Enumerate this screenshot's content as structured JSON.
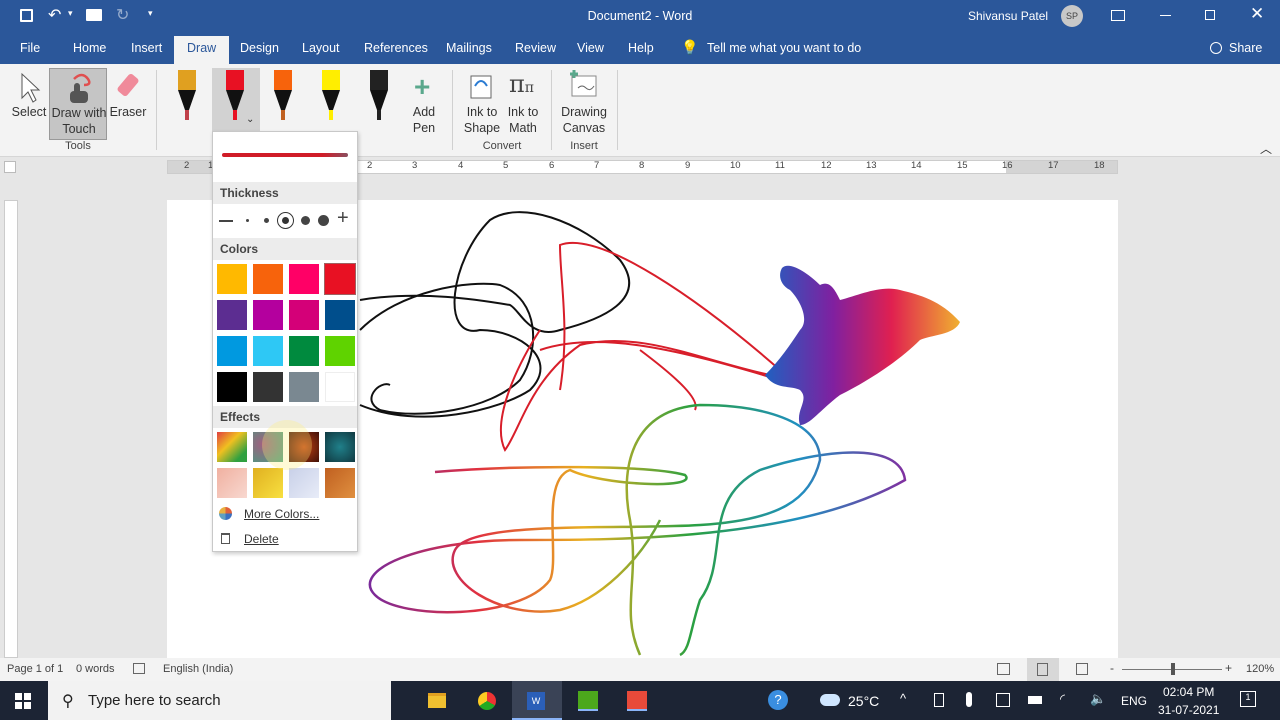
{
  "titlebar": {
    "doc_title": "Document2  -  Word",
    "user": "Shivansu Patel",
    "user_initials": "SP"
  },
  "tabs": [
    "File",
    "Home",
    "Insert",
    "Draw",
    "Design",
    "Layout",
    "References",
    "Mailings",
    "Review",
    "View",
    "Help"
  ],
  "tell_me": "Tell me what you want to do",
  "share": "Share",
  "ribbon": {
    "select": "Select",
    "draw_touch_1": "Draw with",
    "draw_touch_2": "Touch",
    "eraser": "Eraser",
    "tools_group": "Tools",
    "add_pen_1": "Add",
    "add_pen_2": "Pen",
    "ink_shape_1": "Ink to",
    "ink_shape_2": "Shape",
    "ink_math_1": "Ink to",
    "ink_math_2": "Math",
    "convert_group": "Convert",
    "canvas_1": "Drawing",
    "canvas_2": "Canvas",
    "insert_group": "Insert"
  },
  "pens": [
    {
      "color": "#e0a020",
      "tip": "#c0404a"
    },
    {
      "color": "#e81123",
      "tip": "#e81123"
    },
    {
      "color": "#f7630c",
      "tip": "#c06020"
    },
    {
      "color": "#ffee00",
      "tip": "#ffee00"
    },
    {
      "color": "#222222",
      "tip": "#222222"
    }
  ],
  "ruler": {
    "labels": [
      "2",
      "1",
      "1",
      "2",
      "3",
      "4",
      "5",
      "6",
      "7",
      "8",
      "9",
      "10",
      "11",
      "12",
      "13",
      "14",
      "15",
      "16",
      "17",
      "18"
    ]
  },
  "dropdown": {
    "thickness": "Thickness",
    "colors": "Colors",
    "effects": "Effects",
    "more_colors": "More Colors...",
    "delete": "Delete",
    "color_swatches": [
      "#ffb900",
      "#f7630c",
      "#ff0066",
      "#e81123",
      "#5c2d91",
      "#b4009e",
      "#d40078",
      "#004e8c",
      "#0099e0",
      "#2ec8f5",
      "#008a3e",
      "#5fd300",
      "#000000",
      "#333333",
      "#7a8891",
      "#ffffff"
    ],
    "selected_color": "#e81123",
    "effect_swatches": [
      "rainbow",
      "galaxy",
      "lava",
      "ocean",
      "rose-gold",
      "gold",
      "silver",
      "bronze"
    ]
  },
  "status": {
    "page": "Page 1 of 1",
    "words": "0 words",
    "language": "English (India)",
    "zoom": "120%"
  },
  "taskbar": {
    "search": "Type here to search",
    "weather": "25°C",
    "lang": "ENG",
    "time": "02:04 PM",
    "date": "31-07-2021",
    "notifications": "1"
  }
}
